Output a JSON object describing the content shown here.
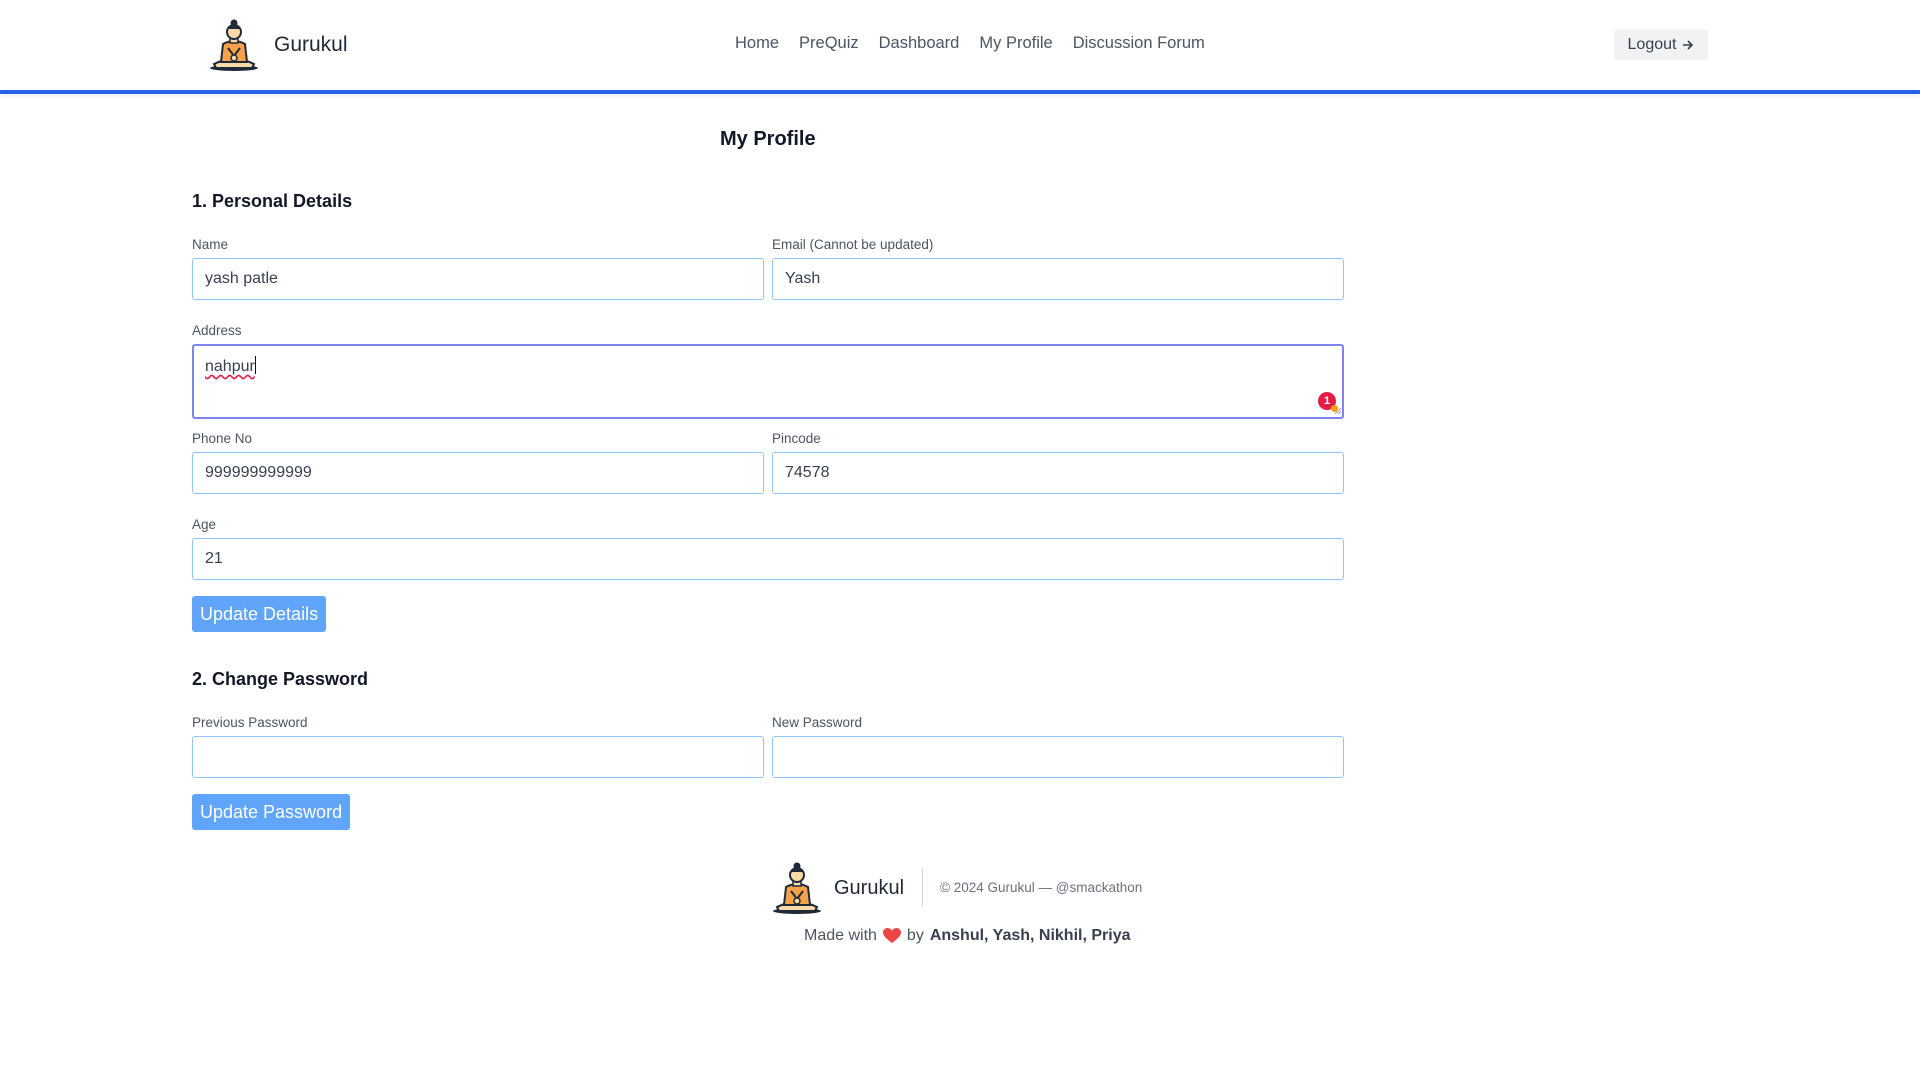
{
  "header": {
    "brand": "Gurukul",
    "nav": [
      "Home",
      "PreQuiz",
      "Dashboard",
      "My Profile",
      "Discussion Forum"
    ],
    "logout_label": "Logout",
    "logout_icon": "arrow-right-icon",
    "accent_color": "#2563eb"
  },
  "page": {
    "title": "My Profile"
  },
  "personal": {
    "section_title": "1. Personal Details",
    "name": {
      "label": "Name",
      "value": "yash patle"
    },
    "email": {
      "label": "Email (Cannot be updated)",
      "value": "Yash"
    },
    "address": {
      "label": "Address",
      "value": "nahpur"
    },
    "grammar_badge": "1",
    "phone": {
      "label": "Phone No",
      "value": "999999999999"
    },
    "pincode": {
      "label": "Pincode",
      "value": "74578"
    },
    "age": {
      "label": "Age",
      "value": "21"
    },
    "update_button": "Update Details"
  },
  "password": {
    "section_title": "2. Change Password",
    "previous": {
      "label": "Previous Password",
      "value": ""
    },
    "new": {
      "label": "New Password",
      "value": ""
    },
    "update_button": "Update Password"
  },
  "footer": {
    "brand": "Gurukul",
    "copyright": "© 2024 Gurukul — @smackathon",
    "made_with": "Made with",
    "by": "by",
    "authors": "Anshul, Yash, Nikhil, Priya"
  }
}
